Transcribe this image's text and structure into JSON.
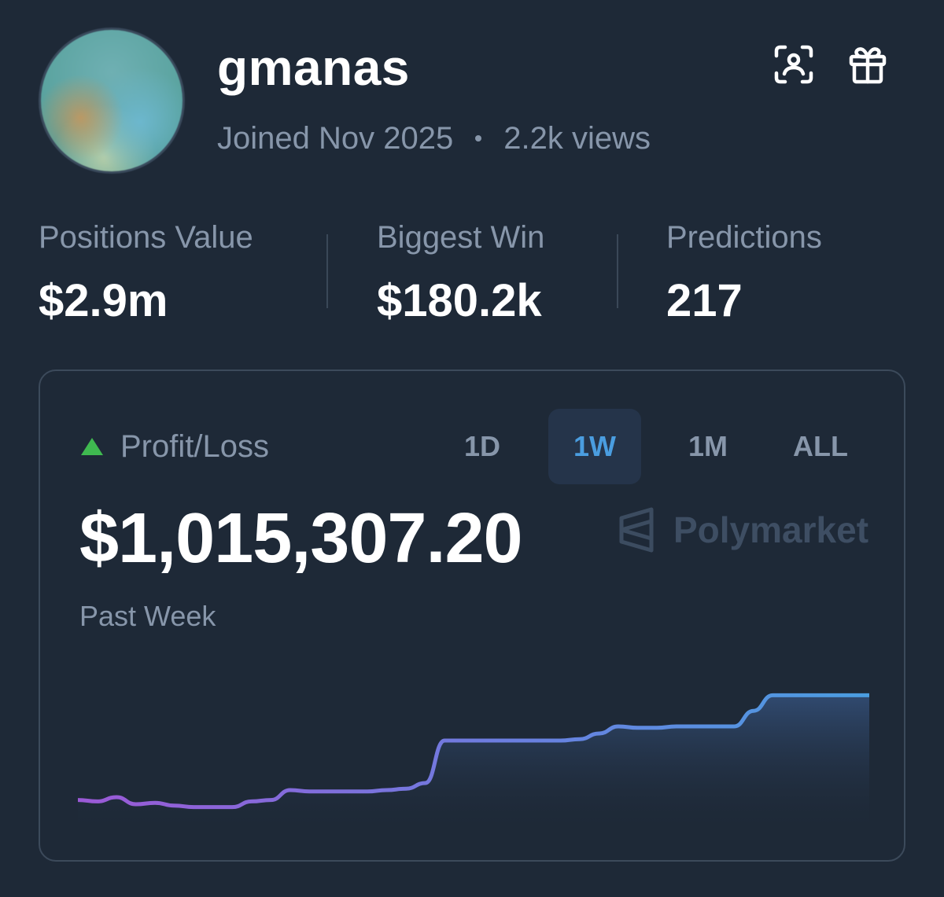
{
  "profile": {
    "username": "gmanas",
    "joined": "Joined Nov 2025",
    "views": "2.2k views"
  },
  "header_icons": {
    "scan": "face-scan-icon",
    "gift": "gift-icon"
  },
  "stats": [
    {
      "label": "Positions Value",
      "value": "$2.9m"
    },
    {
      "label": "Biggest Win",
      "value": "$180.2k"
    },
    {
      "label": "Predictions",
      "value": "217"
    }
  ],
  "pnl": {
    "label": "Profit/Loss",
    "value": "$1,015,307.20",
    "period": "Past Week",
    "trend_icon": "triangle-up-icon",
    "brand": "Polymarket",
    "tabs": [
      {
        "label": "1D",
        "active": false
      },
      {
        "label": "1W",
        "active": true
      },
      {
        "label": "1M",
        "active": false
      },
      {
        "label": "ALL",
        "active": false
      }
    ]
  },
  "colors": {
    "background": "#1e2937",
    "positive": "#3fb950",
    "active_tab_text": "#4a9de0",
    "line_start": "#9b59d6",
    "line_end": "#4a9de0"
  },
  "chart_data": {
    "type": "area",
    "x": [
      0,
      1,
      2,
      3,
      4,
      5,
      6,
      7,
      8,
      9,
      10,
      11,
      12,
      13,
      14,
      15,
      16,
      17,
      18,
      19,
      20,
      21,
      22,
      23,
      24,
      25,
      26,
      27,
      28,
      29,
      30,
      31,
      32,
      33,
      34,
      35,
      36,
      37,
      38,
      39,
      40,
      41
    ],
    "values": [
      8,
      7,
      10,
      5,
      6,
      4,
      3,
      3,
      3,
      7,
      8,
      15,
      14,
      14,
      14,
      14,
      15,
      16,
      20,
      50,
      50,
      50,
      50,
      50,
      50,
      50,
      51,
      55,
      60,
      59,
      59,
      60,
      60,
      60,
      60,
      71,
      82,
      82,
      82,
      82,
      82,
      82
    ],
    "ylim": [
      0,
      100
    ],
    "grid": false,
    "legend": "none"
  }
}
